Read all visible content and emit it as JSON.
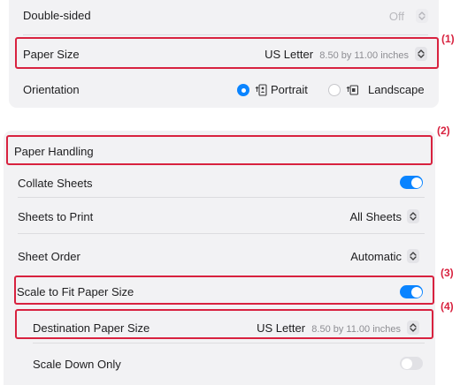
{
  "print_settings": {
    "double_sided": {
      "label": "Double-sided",
      "value": "Off"
    },
    "paper_size": {
      "label": "Paper Size",
      "value": "US Letter",
      "detail": "8.50 by 11.00 inches"
    },
    "orientation": {
      "label": "Orientation",
      "options": [
        {
          "label": "Portrait",
          "selected": true
        },
        {
          "label": "Landscape",
          "selected": false
        }
      ]
    }
  },
  "paper_handling": {
    "title": "Paper Handling",
    "collate_sheets": {
      "label": "Collate Sheets",
      "enabled": true
    },
    "sheets_to_print": {
      "label": "Sheets to Print",
      "value": "All Sheets"
    },
    "sheet_order": {
      "label": "Sheet Order",
      "value": "Automatic"
    },
    "scale_to_fit": {
      "label": "Scale to Fit Paper Size",
      "enabled": true
    },
    "destination_paper_size": {
      "label": "Destination Paper Size",
      "value": "US Letter",
      "detail": "8.50 by 11.00 inches"
    },
    "scale_down_only": {
      "label": "Scale Down Only",
      "enabled": false
    }
  },
  "callouts": [
    "(1)",
    "(2)",
    "(3)",
    "(4)"
  ],
  "colors": {
    "highlight": "#d8223f",
    "accent": "#0a84ff",
    "panel": "#f2f2f4"
  },
  "icons": [
    "chevron-up-down-icon",
    "portrait-orientation-icon",
    "landscape-orientation-icon"
  ]
}
